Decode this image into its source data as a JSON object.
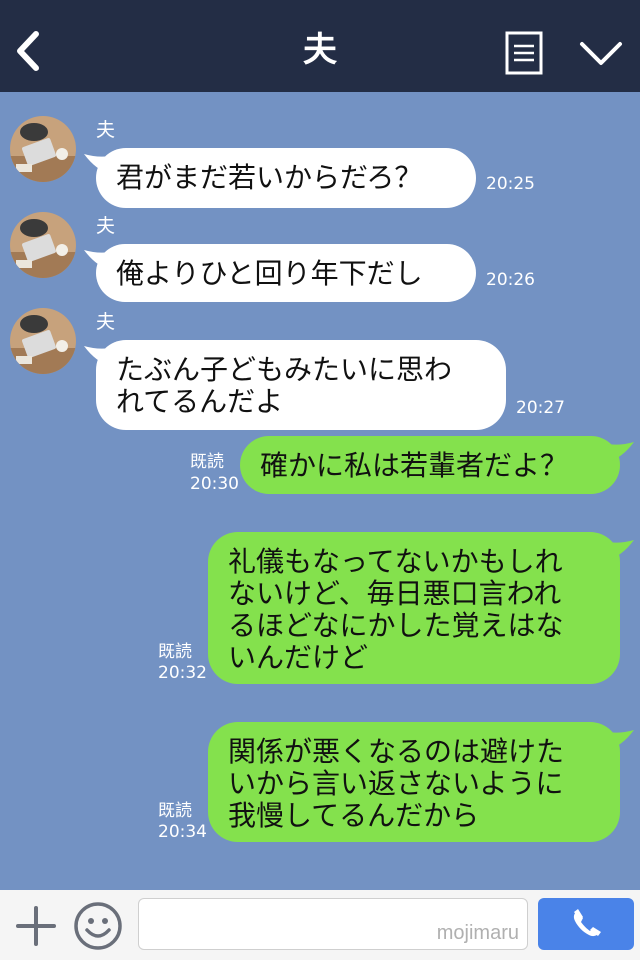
{
  "header": {
    "title": "夫"
  },
  "messages": [
    {
      "sender": "夫",
      "text": "君がまだ若いからだろ？",
      "time": "20:25"
    },
    {
      "sender": "夫",
      "text": "俺よりひと回り年下だし",
      "time": "20:26"
    },
    {
      "sender": "夫",
      "text": "たぶん子どもみたいに思わ\nれてるんだよ",
      "time": "20:27"
    },
    {
      "text": "確かに私は若輩者だよ？",
      "read": "既読",
      "time": "20:30"
    },
    {
      "text": "礼儀もなってないかもしれ\nないけど、毎日悪口言われ\nるほどなにかした覚えはな\nいんだけど",
      "read": "既読",
      "time": "20:32"
    },
    {
      "text": "関係が悪くなるのは避けた\nいから言い返さないように\n我慢してるんだから",
      "read": "既読",
      "time": "20:34"
    }
  ],
  "footer": {
    "watermark": "mojimaru"
  },
  "colors": {
    "background": "#7392c3",
    "header": "#232d45",
    "incoming_bubble": "#ffffff",
    "outgoing_bubble": "#84e14d",
    "send_button": "#4a83e8"
  }
}
